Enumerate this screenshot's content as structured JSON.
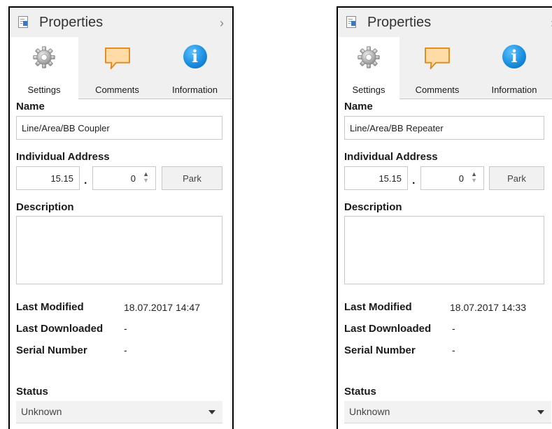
{
  "left_panel": {
    "title": "Properties",
    "collapse_glyph": "›",
    "tabs": [
      {
        "label": "Settings",
        "icon": "gear-icon"
      },
      {
        "label": "Comments",
        "icon": "comment-bubble-icon"
      },
      {
        "label": "Information",
        "icon": "info-icon"
      }
    ],
    "name_label": "Name",
    "name_value": "Line/Area/BB Coupler",
    "address_label": "Individual Address",
    "address_part1": "15.15",
    "address_separator": ".",
    "address_part2": "0",
    "park_label": "Park",
    "description_label": "Description",
    "description_value": "",
    "last_modified_label": "Last Modified",
    "last_modified_value": "18.07.2017 14:47",
    "last_downloaded_label": "Last Downloaded",
    "last_downloaded_value": "-",
    "serial_label": "Serial Number",
    "serial_value": "-",
    "status_label": "Status",
    "status_value": "Unknown"
  },
  "right_panel": {
    "title": "Properties",
    "collapse_glyph": "›",
    "tabs": [
      {
        "label": "Settings",
        "icon": "gear-icon"
      },
      {
        "label": "Comments",
        "icon": "comment-bubble-icon"
      },
      {
        "label": "Information",
        "icon": "info-icon"
      }
    ],
    "name_label": "Name",
    "name_value": "Line/Area/BB Repeater",
    "address_label": "Individual Address",
    "address_part1": "15.15",
    "address_separator": ".",
    "address_part2": "0",
    "park_label": "Park",
    "description_label": "Description",
    "description_value": "",
    "last_modified_label": "Last Modified",
    "last_modified_value": "18.07.2017 14:33",
    "last_downloaded_label": "Last Downloaded",
    "last_downloaded_value": "-",
    "serial_label": "Serial Number",
    "serial_value": "-",
    "status_label": "Status",
    "status_value": "Unknown"
  },
  "colors": {
    "panel_bg": "#ffffff",
    "chrome_bg": "#f0f0f0",
    "info_blue": "#1a8fe0",
    "comment_orange": "#f5a623",
    "field_border": "#c9c9c9"
  },
  "info_glyph": "i",
  "spin_up": "▲",
  "spin_down": "▼"
}
